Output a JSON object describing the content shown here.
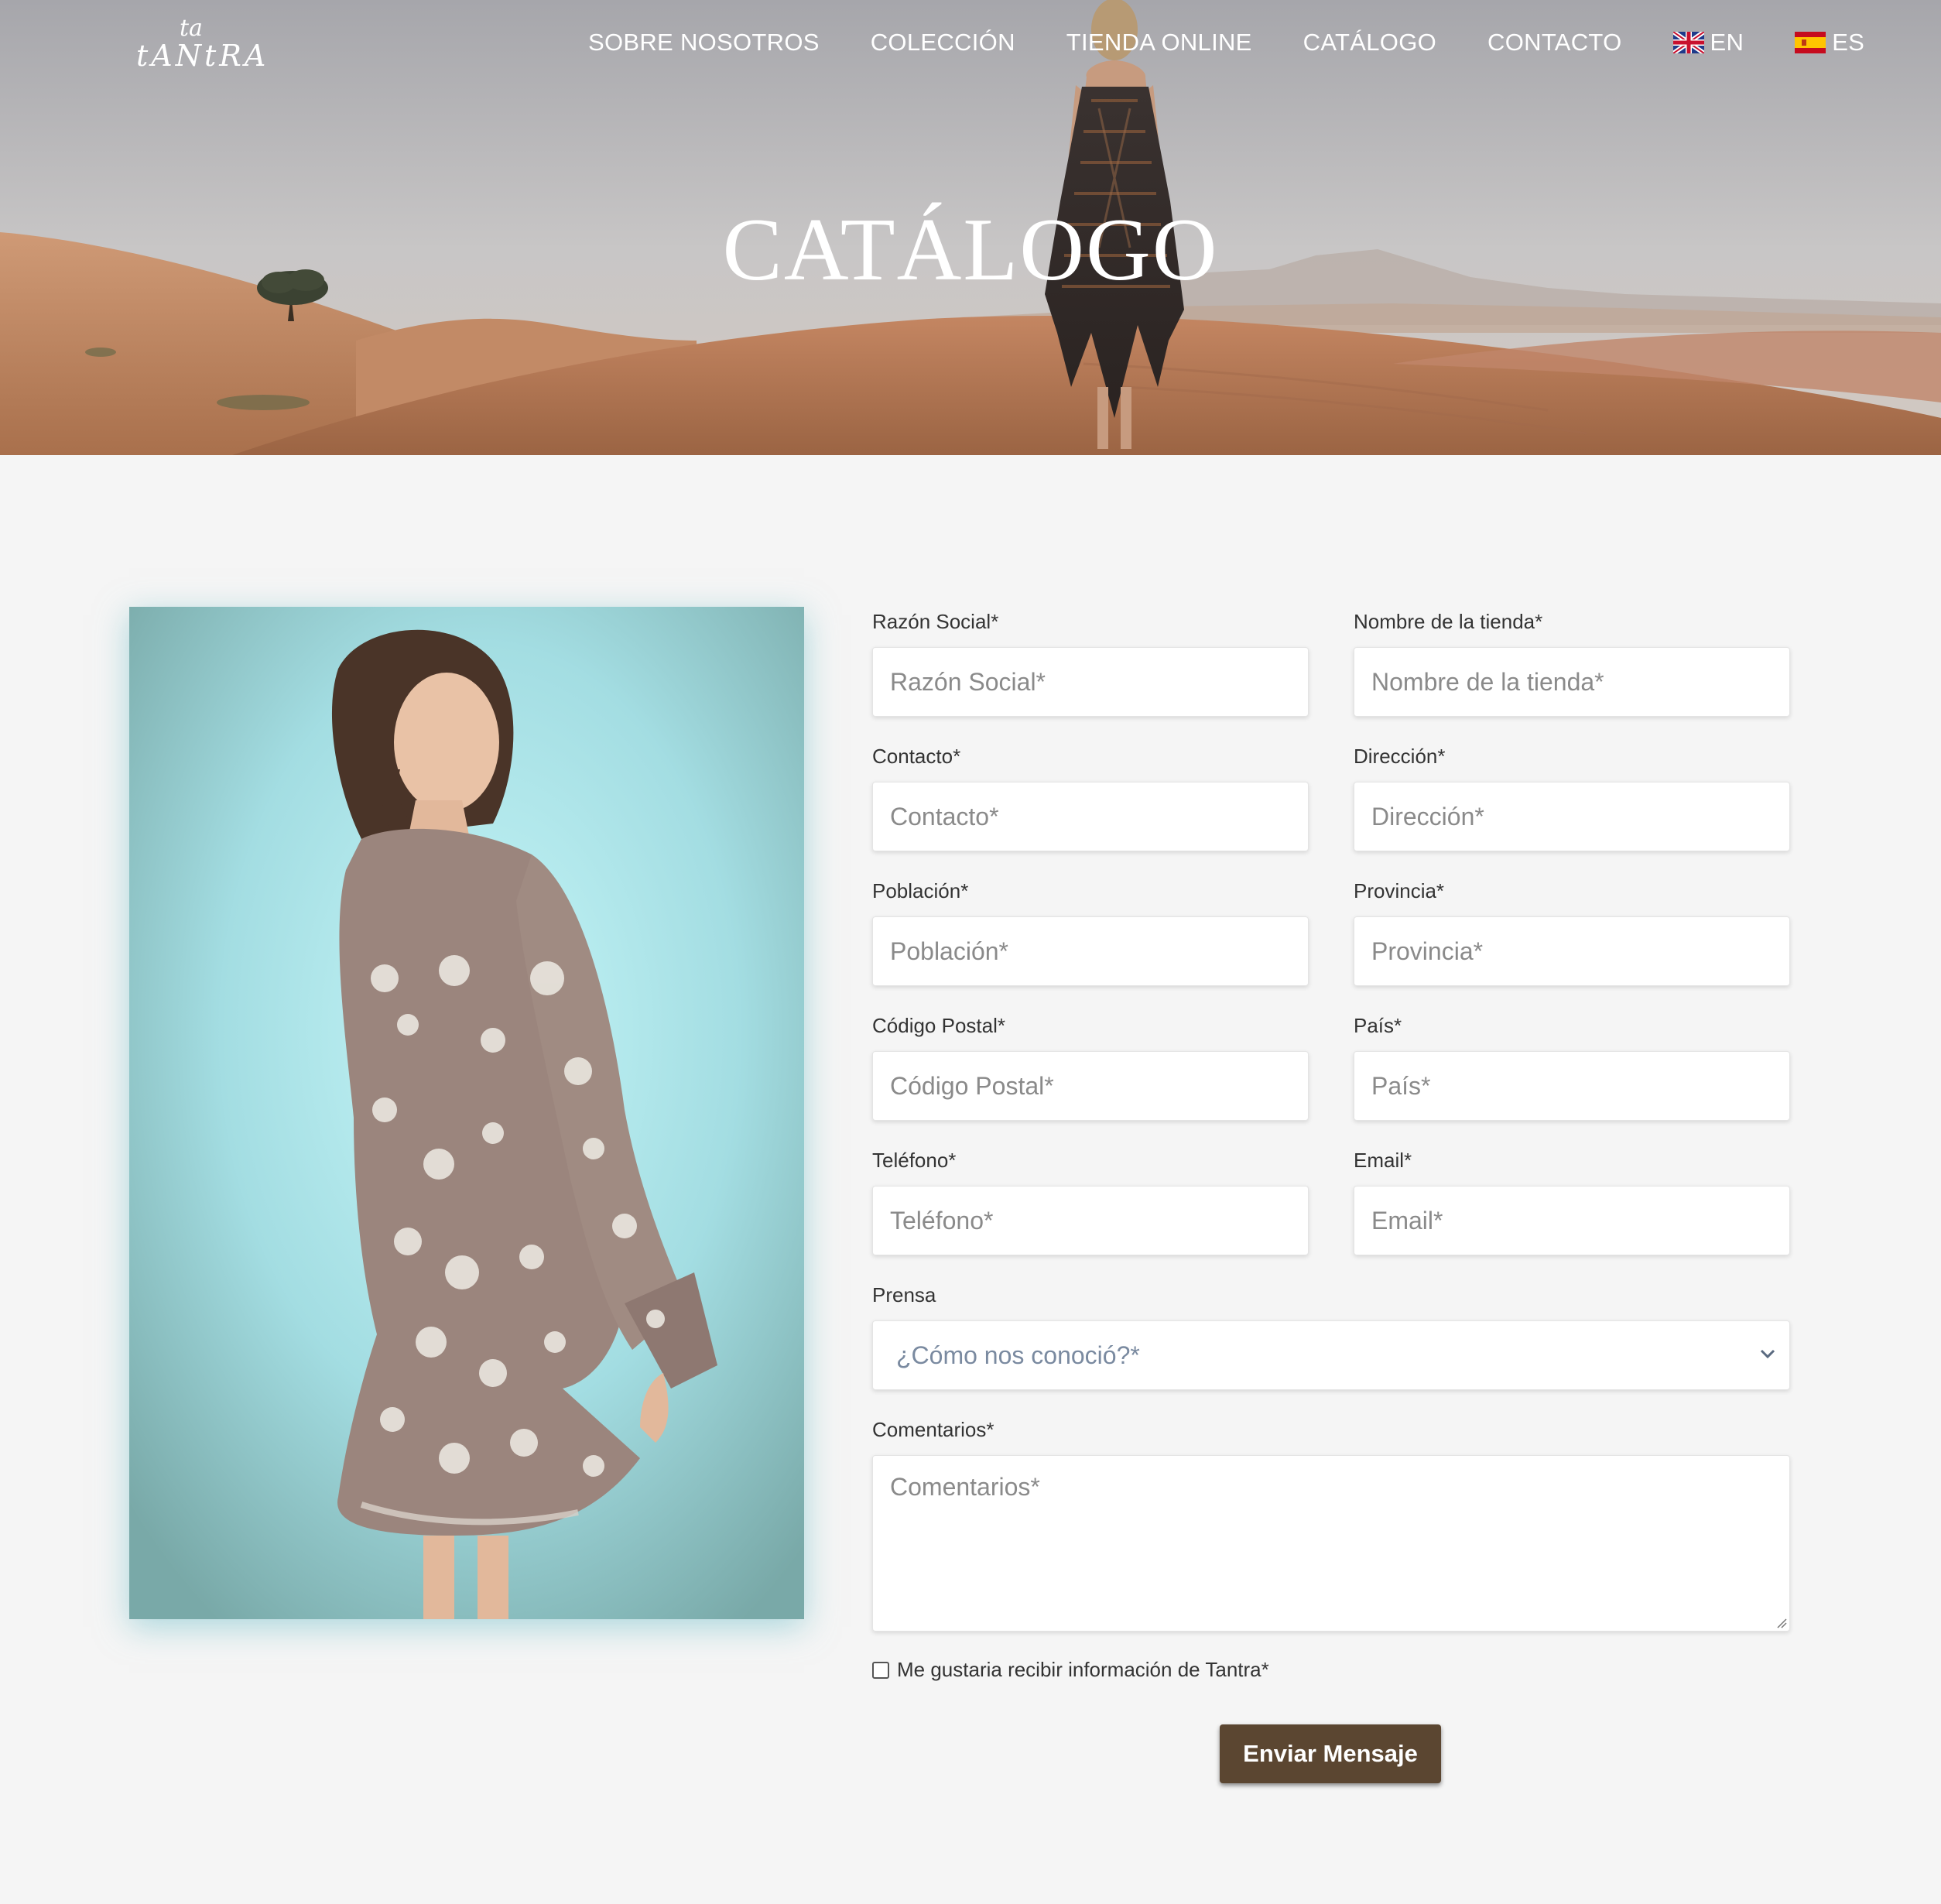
{
  "brand": {
    "logo_mark": "ta",
    "logo_word": "tANtRA"
  },
  "nav": {
    "items": [
      "SOBRE NOSOTROS",
      "COLECCIÓN",
      "TIENDA ONLINE",
      "CATÁLOGO",
      "CONTACTO"
    ],
    "languages": [
      {
        "code": "EN",
        "flag": "uk-flag-icon"
      },
      {
        "code": "ES",
        "flag": "spain-flag-icon"
      }
    ]
  },
  "hero": {
    "title": "CATÁLOGO"
  },
  "form": {
    "fields": [
      {
        "label": "Razón Social*",
        "placeholder": "Razón Social*",
        "value": ""
      },
      {
        "label": "Nombre de la tienda*",
        "placeholder": "Nombre de la tienda*",
        "value": ""
      },
      {
        "label": "Contacto*",
        "placeholder": "Contacto*",
        "value": ""
      },
      {
        "label": "Dirección*",
        "placeholder": "Dirección*",
        "value": ""
      },
      {
        "label": "Población*",
        "placeholder": "Población*",
        "value": ""
      },
      {
        "label": "Provincia*",
        "placeholder": "Provincia*",
        "value": ""
      },
      {
        "label": "Código Postal*",
        "placeholder": "Código Postal*",
        "value": ""
      },
      {
        "label": "País*",
        "placeholder": "País*",
        "value": ""
      },
      {
        "label": "Teléfono*",
        "placeholder": "Teléfono*",
        "value": ""
      },
      {
        "label": "Email*",
        "placeholder": "Email*",
        "value": ""
      }
    ],
    "prensa": {
      "label": "Prensa",
      "selected": "¿Cómo nos conoció?*"
    },
    "comments": {
      "label": "Comentarios*",
      "placeholder": "Comentarios*",
      "value": ""
    },
    "consent": {
      "label": "Me gustaria recibir información de Tantra*",
      "checked": false
    },
    "submit_label": "Enviar Mensaje"
  },
  "colors": {
    "submit_bg": "#5b4631",
    "page_bg": "#f5f5f5",
    "photo_bg": "#a9dde3"
  }
}
